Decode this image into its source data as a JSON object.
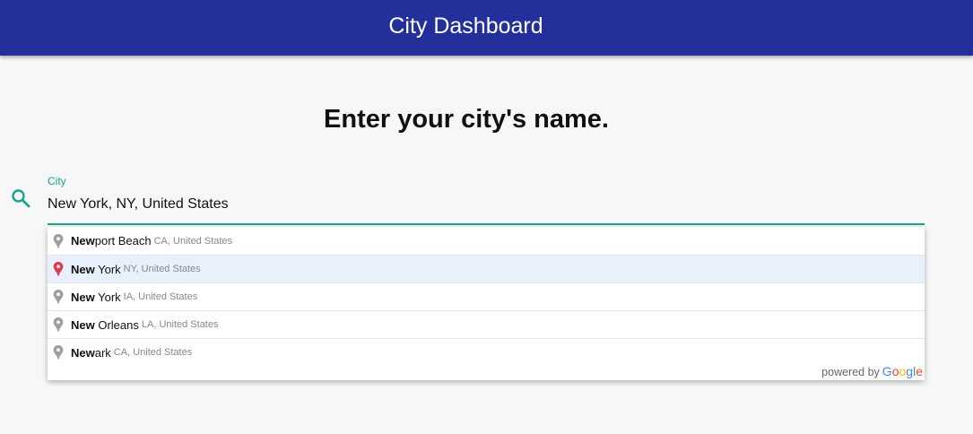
{
  "header": {
    "title": "City Dashboard",
    "background": "#232f9b"
  },
  "main": {
    "prompt": "Enter your city's name."
  },
  "search": {
    "icon": "search-icon",
    "label": "City",
    "value": "New York, NY, United States",
    "accent": "#1aa38e"
  },
  "autocomplete": {
    "items": [
      {
        "match": "New",
        "rest": "port Beach",
        "secondary": "CA, United States",
        "selected": false
      },
      {
        "match": "New",
        "rest": " York",
        "secondary": "NY, United States",
        "selected": true
      },
      {
        "match": "New",
        "rest": " York",
        "secondary": "IA, United States",
        "selected": false
      },
      {
        "match": "New",
        "rest": " Orleans",
        "secondary": "LA, United States",
        "selected": false
      },
      {
        "match": "New",
        "rest": "ark",
        "secondary": "CA, United States",
        "selected": false
      }
    ],
    "pin_color": "#9e9e9e",
    "selected_pin_color": "#e53950",
    "powered_by": "powered by",
    "logo": [
      "G",
      "o",
      "o",
      "g",
      "l",
      "e"
    ]
  }
}
